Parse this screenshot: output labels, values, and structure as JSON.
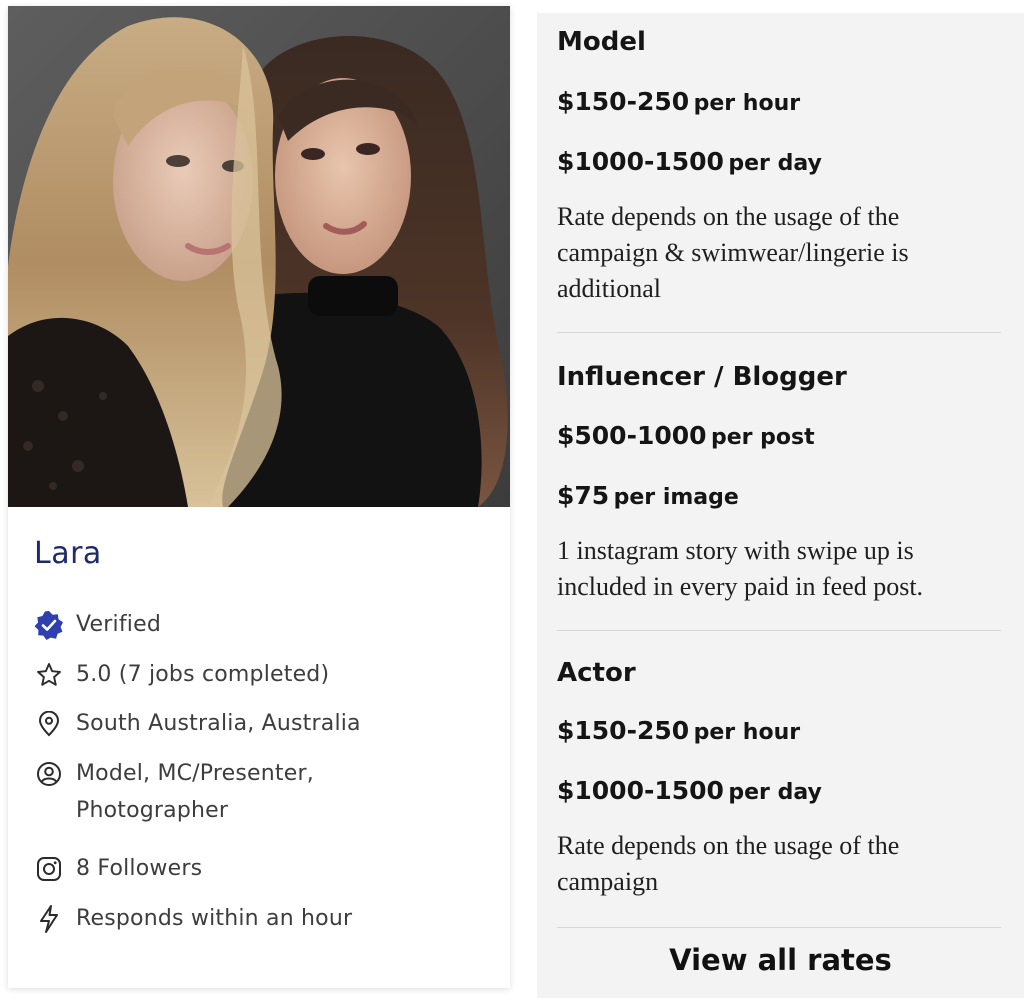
{
  "profile": {
    "name": "Lara",
    "photo_alt": "Profile photo of two models",
    "details": [
      {
        "icon": "verified-badge-icon",
        "text": "Verified"
      },
      {
        "icon": "star-icon",
        "text": "5.0 (7 jobs completed)"
      },
      {
        "icon": "location-pin-icon",
        "text": "South Australia, Australia"
      },
      {
        "icon": "user-circle-icon",
        "text": "Model, MC/Presenter, Photographer"
      },
      {
        "icon": "instagram-icon",
        "text": "8 Followers"
      },
      {
        "icon": "lightning-icon",
        "text": "Responds within an hour"
      }
    ],
    "accent_color": "#1f2a6b",
    "verified_color": "#2f3fb0"
  },
  "rates": {
    "sections": [
      {
        "title": "Model",
        "prices": [
          {
            "amount": "$150-250",
            "unit": "per hour"
          },
          {
            "amount": "$1000-1500",
            "unit": "per day"
          }
        ],
        "note": "Rate depends on the usage of the campaign & swimwear/lingerie is additional"
      },
      {
        "title": "Influencer / Blogger",
        "prices": [
          {
            "amount": "$500-1000",
            "unit": "per post"
          },
          {
            "amount": "$75",
            "unit": "per image"
          }
        ],
        "note": "1 instagram story with swipe up is included in every paid in feed post."
      },
      {
        "title": "Actor",
        "prices": [
          {
            "amount": "$150-250",
            "unit": "per hour"
          },
          {
            "amount": "$1000-1500",
            "unit": "per day"
          }
        ],
        "note": "Rate depends on the usage of the campaign"
      }
    ],
    "view_all_label": "View all rates"
  }
}
